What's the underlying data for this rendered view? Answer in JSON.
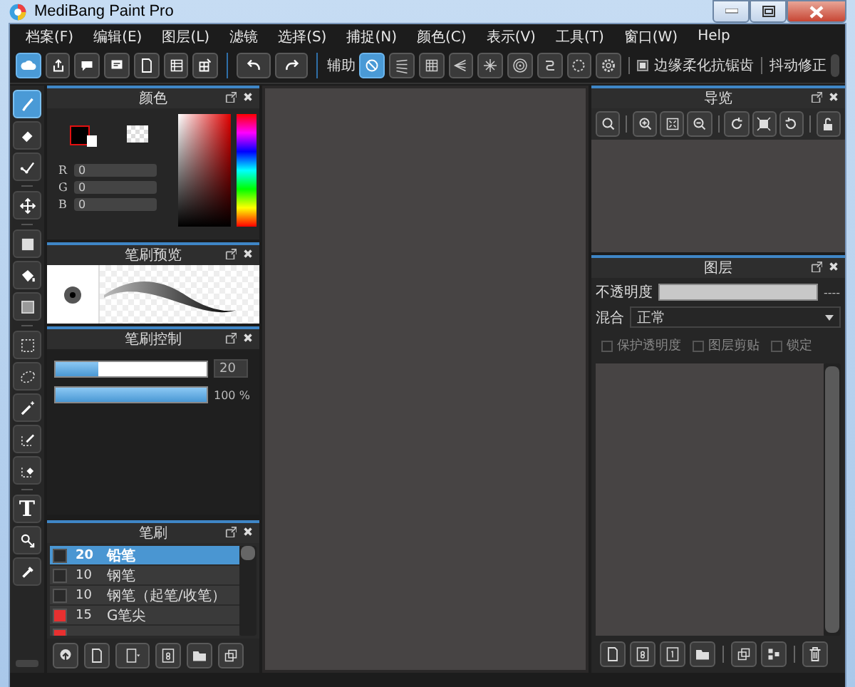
{
  "window": {
    "title": "MediBang Paint Pro"
  },
  "menu": [
    "档案(F)",
    "编辑(E)",
    "图层(L)",
    "滤镜",
    "选择(S)",
    "捕捉(N)",
    "颜色(C)",
    "表示(V)",
    "工具(T)",
    "窗口(W)",
    "Help"
  ],
  "toolbar": {
    "assist_label": "辅助",
    "snap_modes": [
      {
        "selected": true
      },
      {
        "selected": false
      },
      {
        "selected": false
      },
      {
        "selected": false
      },
      {
        "selected": false
      },
      {
        "selected": false
      },
      {
        "selected": false
      },
      {
        "selected": false
      },
      {
        "selected": false
      }
    ],
    "antialias": {
      "label": "边缘柔化抗锯齿",
      "checked": true
    },
    "stabilizer": {
      "label": "抖动修正"
    }
  },
  "tools": [
    {
      "selected": true
    },
    {
      "selected": false
    },
    {
      "selected": false
    },
    {
      "selected": false
    },
    {
      "selected": false
    },
    {
      "selected": false
    },
    {
      "selected": false
    },
    {
      "selected": false
    },
    {
      "selected": false
    },
    {
      "selected": false
    },
    {
      "selected": false
    },
    {
      "selected": false
    },
    {
      "selected": false,
      "glyph": "T"
    },
    {
      "selected": false
    },
    {
      "selected": false
    }
  ],
  "color_panel": {
    "title": "颜色",
    "channels": [
      {
        "label": "R",
        "value": "0"
      },
      {
        "label": "G",
        "value": "0"
      },
      {
        "label": "B",
        "value": "0"
      }
    ]
  },
  "brush_preview": {
    "title": "笔刷预览"
  },
  "brush_control": {
    "title": "笔刷控制",
    "size": {
      "level": 0.28,
      "value": "20"
    },
    "opacity": {
      "level": 1,
      "reading": "100 %"
    }
  },
  "brushes": {
    "title": "笔刷",
    "items": [
      {
        "size": "20",
        "name": "铅笔",
        "color": "#2a2a2a",
        "selected": true
      },
      {
        "size": "10",
        "name": "钢笔",
        "color": "#2a2a2a",
        "selected": false
      },
      {
        "size": "10",
        "name": "钢笔（起笔/收笔）",
        "color": "#2a2a2a",
        "selected": false
      },
      {
        "size": "15",
        "name": "G笔尖",
        "color": "#e83030",
        "selected": false
      },
      {
        "color": "#e83030",
        "selected": false
      }
    ]
  },
  "navigator": {
    "title": "导览"
  },
  "layers": {
    "title": "图层",
    "opacity_label": "不透明度",
    "opacity_reading": "----",
    "blend_label": "混合",
    "blend_value": "正常",
    "options": [
      {
        "label": "保护透明度",
        "checked": false
      },
      {
        "label": "图层剪贴",
        "checked": false
      },
      {
        "label": "锁定",
        "checked": false
      }
    ]
  }
}
